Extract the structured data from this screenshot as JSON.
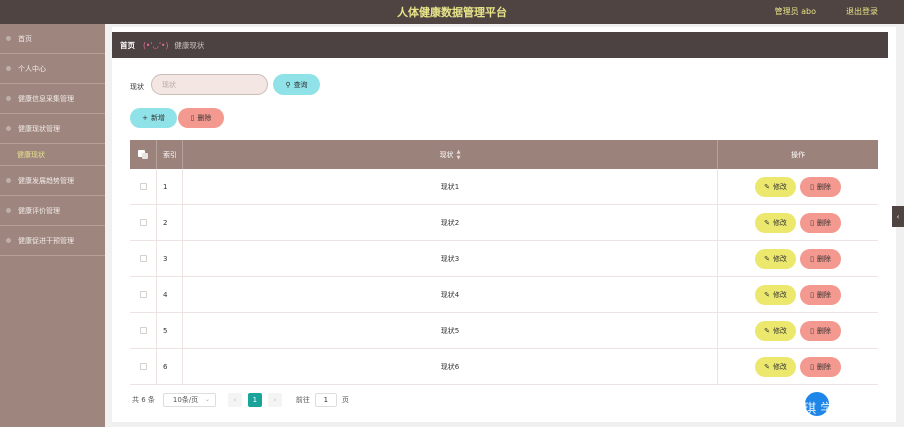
{
  "header": {
    "title": "人体健康数据管理平台",
    "user": "管理员 abo",
    "logout": "退出登录"
  },
  "sidebar": {
    "items": [
      {
        "label": "首页"
      },
      {
        "label": "个人中心"
      },
      {
        "label": "健康信息采集管理"
      },
      {
        "label": "健康现状管理"
      },
      {
        "label": "健康现状"
      },
      {
        "label": "健康发展趋势管理"
      },
      {
        "label": "健康评价管理"
      },
      {
        "label": "健康促进干预管理"
      }
    ]
  },
  "breadcrumb": {
    "home": "首页",
    "face": "(•'◡'•)",
    "current": "健康现状"
  },
  "search": {
    "label": "现状",
    "placeholder": "现状",
    "button": "查询"
  },
  "actions": {
    "add": "新增",
    "delete": "删除"
  },
  "table": {
    "headers": {
      "index": "索引",
      "name": "现状",
      "ops": "操作"
    },
    "edit_label": "修改",
    "delete_label": "删除",
    "rows": [
      {
        "index": "1",
        "name": "现状1"
      },
      {
        "index": "2",
        "name": "现状2"
      },
      {
        "index": "3",
        "name": "现状3"
      },
      {
        "index": "4",
        "name": "现状4"
      },
      {
        "index": "5",
        "name": "现状5"
      },
      {
        "index": "6",
        "name": "现状6"
      }
    ]
  },
  "pagination": {
    "total": "共 6 条",
    "page_size": "10条/页",
    "current_page": "1",
    "goto_label": "前往",
    "goto_value": "1",
    "goto_suffix": "页"
  },
  "watermark": "CSDN @琪琪 学姐",
  "colors": {
    "topbar": "#4f4441",
    "sidebar": "#9e857e",
    "accent_yellow": "#e8e48a",
    "cyan_button": "#8fe3e8",
    "red_button": "#f4998f",
    "edit_button": "#ece86e",
    "table_header": "#9b827b",
    "pager_active": "#19a39a"
  }
}
